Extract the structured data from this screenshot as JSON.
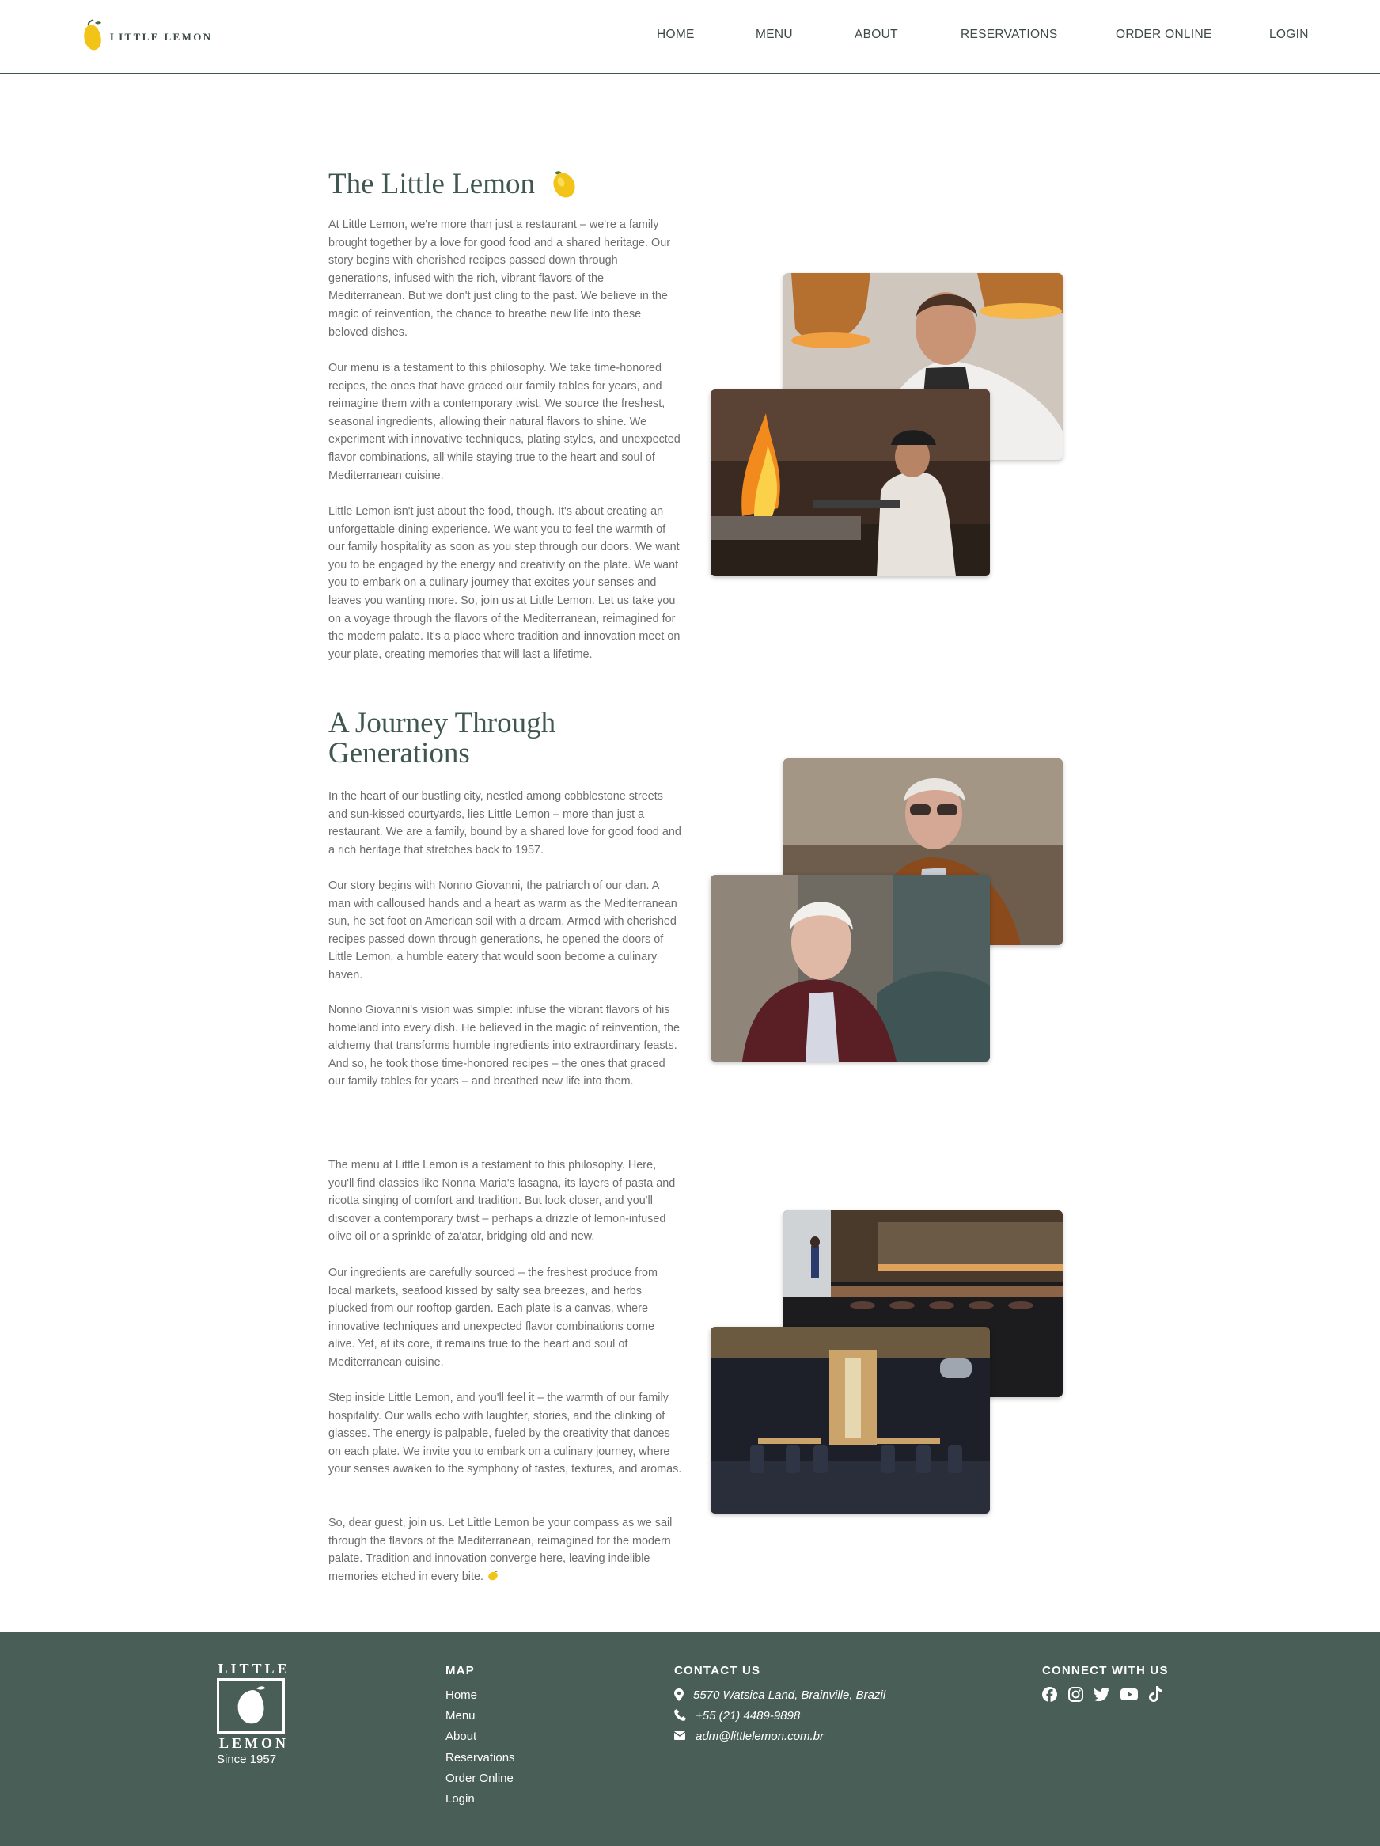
{
  "header": {
    "brand": "LITTLE LEMON",
    "nav": [
      "HOME",
      "MENU",
      "ABOUT",
      "RESERVATIONS",
      "ORDER ONLINE",
      "LOGIN"
    ]
  },
  "section1": {
    "title": "The Little Lemon",
    "paragraphs": [
      "At Little Lemon, we're more than just a restaurant – we're a family brought together by a love for good food and a shared heritage. Our story begins with cherished recipes passed down through generations, infused with the rich, vibrant flavors of the Mediterranean. But we don't just cling to the past. We believe in the magic of reinvention, the chance to breathe new life into these beloved dishes.",
      "Our menu is a testament to this philosophy. We take time-honored recipes, the ones that have graced our family tables for years, and reimagine them with a contemporary twist. We source the freshest, seasonal ingredients, allowing their natural flavors to shine. We experiment with innovative techniques, plating styles, and unexpected flavor combinations, all while staying true to the heart and soul of Mediterranean cuisine.",
      "Little Lemon isn't just about the food, though. It's about creating an unforgettable dining experience. We want you to feel the warmth of our family hospitality as soon as you step through our doors. We want you to be engaged by the energy and creativity on the plate. We want you to embark on a culinary journey that excites your senses and leaves you wanting more. So, join us at Little Lemon. Let us take you on a voyage through the flavors of the Mediterranean, reimagined for the modern palate. It's a place where tradition and innovation meet on your plate, creating memories that will last a lifetime."
    ]
  },
  "section2": {
    "title_line1": "A Journey Through",
    "title_line2": "Generations",
    "paragraphs": [
      "In the heart of our bustling city, nestled among cobblestone streets and sun-kissed courtyards, lies Little Lemon – more than just a restaurant. We are a family, bound by a shared love for good food and a rich heritage that stretches back to 1957.",
      "Our story begins with Nonno Giovanni, the patriarch of our clan. A man with calloused hands and a heart as warm as the Mediterranean sun, he set foot on American soil with a dream. Armed with cherished recipes passed down through generations, he opened the doors of Little Lemon, a humble eatery that would soon become a culinary haven.",
      "Nonno Giovanni's vision was simple: infuse the vibrant flavors of his homeland into every dish. He believed in the magic of reinvention, the alchemy that transforms humble ingredients into extraordinary feasts. And so, he took those time-honored recipes – the ones that graced our family tables for years – and breathed new life into them."
    ]
  },
  "section3": {
    "paragraphs": [
      "The menu at Little Lemon is a testament to this philosophy. Here, you'll find classics like Nonna Maria's lasagna, its layers of pasta and ricotta singing of comfort and tradition. But look closer, and you'll discover a contemporary twist – perhaps a drizzle of lemon-infused olive oil or a sprinkle of za'atar, bridging old and new.",
      "Our ingredients are carefully sourced – the freshest produce from local markets, seafood kissed by salty sea breezes, and herbs plucked from our rooftop garden. Each plate is a canvas, where innovative techniques and unexpected flavor combinations come alive. Yet, at its core, it remains true to the heart and soul of Mediterranean cuisine.",
      "Step inside Little Lemon, and you'll feel it – the warmth of our family hospitality. Our walls echo with laughter, stories, and the clinking of glasses. The energy is palpable, fueled by the creativity that dances on each plate. We invite you to embark on a culinary journey, where your senses awaken to the symphony of tastes, textures, and aromas.",
      "So, dear guest, join us. Let Little Lemon be your compass as we sail through the flavors of the Mediterranean, reimagined for the modern palate. Tradition and innovation converge here, leaving indelible memories etched in every bite."
    ]
  },
  "footer": {
    "logo_top": "LITTLE",
    "logo_bottom": "LEMON",
    "since": "Since 1957",
    "map_heading": "MAP",
    "map_links": [
      "Home",
      "Menu",
      "About",
      "Reservations",
      "Order Online",
      "Login"
    ],
    "contact_heading": "CONTACT US",
    "address": "5570 Watsica Land, Brainville, Brazil",
    "phone": "+55 (21) 4489-9898",
    "email": "adm@littlelemon.com.br",
    "social_heading": "CONNECT WITH US",
    "social_icons": [
      "facebook-icon",
      "instagram-icon",
      "twitter-icon",
      "youtube-icon",
      "tiktok-icon"
    ]
  },
  "colors": {
    "brand_green": "#495e57",
    "lemon_yellow": "#f4ce14",
    "heading": "#3f5750"
  }
}
